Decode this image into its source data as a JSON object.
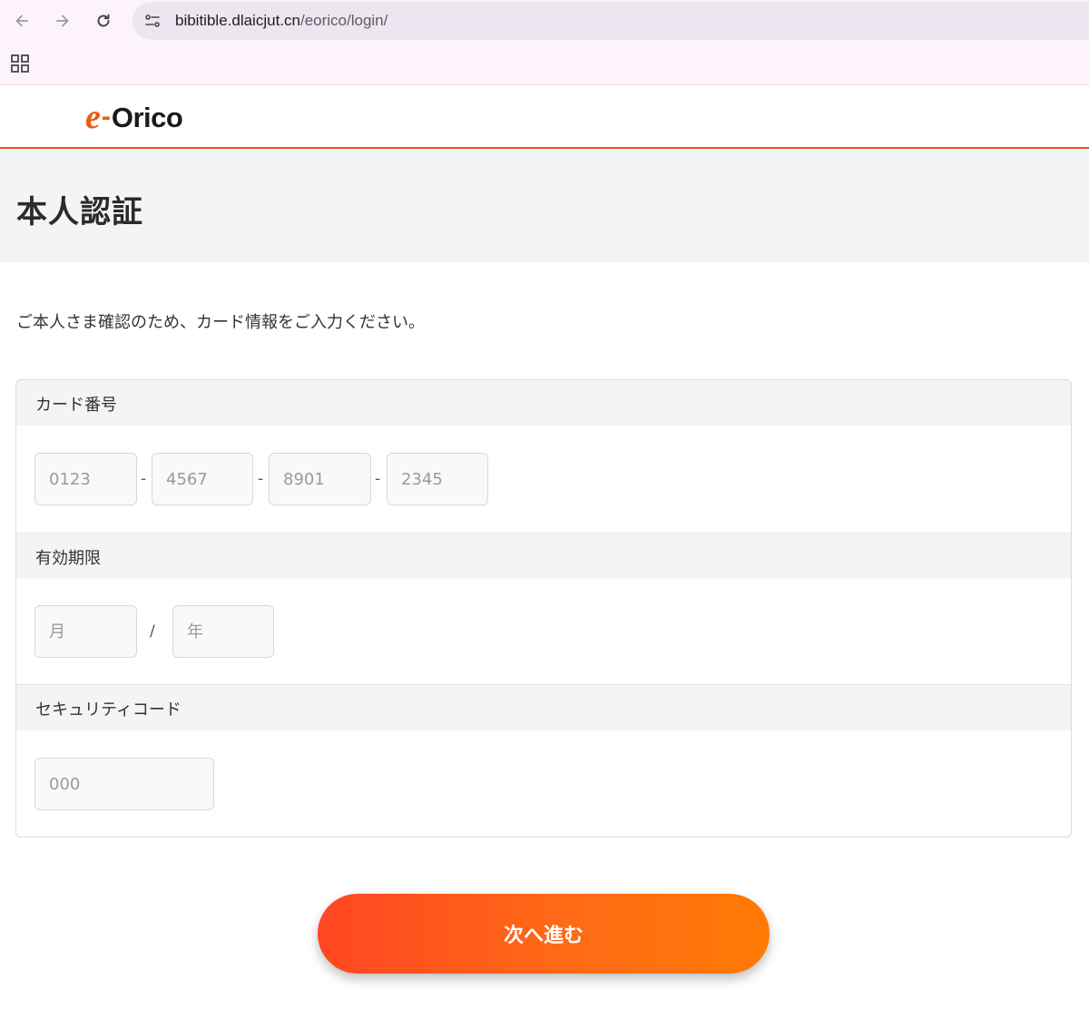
{
  "browser": {
    "url_host": "bibitible.dlaicjut.cn",
    "url_path": "/eorico/login/"
  },
  "header": {
    "logo_e": "e",
    "logo_dash": "-",
    "logo_word": "Orico"
  },
  "page": {
    "title": "本人認証",
    "intro": "ご本人さま確認のため、カード情報をご入力ください。"
  },
  "form": {
    "card_number": {
      "label": "カード番号",
      "placeholders": [
        "0123",
        "4567",
        "8901",
        "2345"
      ],
      "separator": "-"
    },
    "expiry": {
      "label": "有効期限",
      "month_placeholder": "月",
      "year_placeholder": "年",
      "separator": "/"
    },
    "security_code": {
      "label": "セキュリティコード",
      "placeholder": "000"
    }
  },
  "next_button": {
    "label": "次へ進む"
  },
  "colors": {
    "brand_orange": "#ea5b14",
    "header_border": "#e8501e",
    "button_gradient_start": "#ff4622",
    "button_gradient_end": "#ff7a05"
  }
}
